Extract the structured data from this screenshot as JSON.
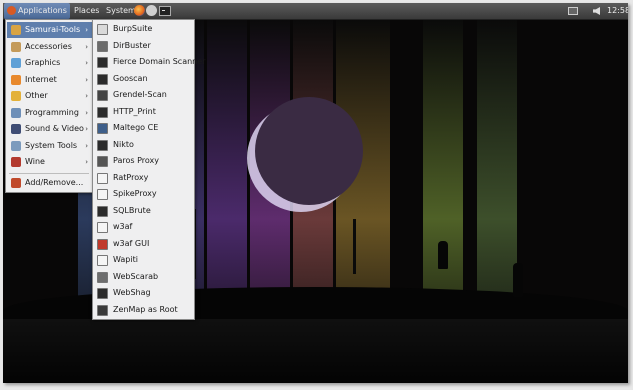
{
  "panel": {
    "applications_label": "Applications",
    "places_label": "Places",
    "system_label": "System",
    "clock": "12:58"
  },
  "apps_menu": [
    {
      "label": "Samurai-Tools",
      "icon": "folder-icon",
      "color": "#d9a443",
      "submenu": true,
      "selected": true
    },
    {
      "label": "Accessories",
      "icon": "accessories-icon",
      "color": "#c49a59",
      "submenu": true
    },
    {
      "label": "Graphics",
      "icon": "graphics-icon",
      "color": "#5fa0d6",
      "submenu": true
    },
    {
      "label": "Internet",
      "icon": "internet-icon",
      "color": "#e8892d",
      "submenu": true
    },
    {
      "label": "Other",
      "icon": "other-icon",
      "color": "#e3b13a",
      "submenu": true
    },
    {
      "label": "Programming",
      "icon": "programming-icon",
      "color": "#6e8fb8",
      "submenu": true
    },
    {
      "label": "Sound & Video",
      "icon": "sound-video-icon",
      "color": "#3f4d74",
      "submenu": true
    },
    {
      "label": "System Tools",
      "icon": "system-tools-icon",
      "color": "#7c9bbd",
      "submenu": true
    },
    {
      "label": "Wine",
      "icon": "wine-icon",
      "color": "#b33a2e",
      "submenu": true
    }
  ],
  "apps_menu_footer": {
    "label": "Add/Remove...",
    "icon": "add-remove-icon",
    "color": "#c04a2c"
  },
  "samurai_tools": [
    {
      "label": "BurpSuite",
      "icon": "burpsuite-icon",
      "color": "#d9d9d9"
    },
    {
      "label": "DirBuster",
      "icon": "dirbuster-icon",
      "color": "#6b6b6b"
    },
    {
      "label": "Fierce Domain Scanner",
      "icon": "terminal-icon",
      "color": "#2b2b2b"
    },
    {
      "label": "Gooscan",
      "icon": "terminal-icon",
      "color": "#2b2b2b"
    },
    {
      "label": "Grendel-Scan",
      "icon": "grendel-icon",
      "color": "#444444"
    },
    {
      "label": "HTTP_Print",
      "icon": "terminal-icon",
      "color": "#2b2b2b"
    },
    {
      "label": "Maltego CE",
      "icon": "maltego-icon",
      "color": "#3e5f8a"
    },
    {
      "label": "Nikto",
      "icon": "terminal-icon",
      "color": "#2b2b2b"
    },
    {
      "label": "Paros Proxy",
      "icon": "paros-icon",
      "color": "#555555"
    },
    {
      "label": "RatProxy",
      "icon": "blank-icon",
      "color": "#f5f5f5"
    },
    {
      "label": "SpikeProxy",
      "icon": "blank-icon",
      "color": "#f5f5f5"
    },
    {
      "label": "SQLBrute",
      "icon": "terminal-icon",
      "color": "#2b2b2b"
    },
    {
      "label": "w3af",
      "icon": "blank-icon",
      "color": "#f5f5f5"
    },
    {
      "label": "w3af GUI",
      "icon": "w3af-gui-icon",
      "color": "#c0392b"
    },
    {
      "label": "Wapiti",
      "icon": "blank-icon",
      "color": "#f5f5f5"
    },
    {
      "label": "WebScarab",
      "icon": "webscarab-icon",
      "color": "#6d6d6d"
    },
    {
      "label": "WebShag",
      "icon": "terminal-icon",
      "color": "#2b2b2b"
    },
    {
      "label": "ZenMap as Root",
      "icon": "zenmap-icon",
      "color": "#3a3a3a"
    }
  ],
  "wallpaper": {
    "strip_colors": [
      "#2b3a5c",
      "#283e66",
      "#3a2f63",
      "#4b2a6b",
      "#5e2c6d",
      "#6a3a3a",
      "#6a5524",
      "#4f6127",
      "#3d4f2b"
    ]
  }
}
